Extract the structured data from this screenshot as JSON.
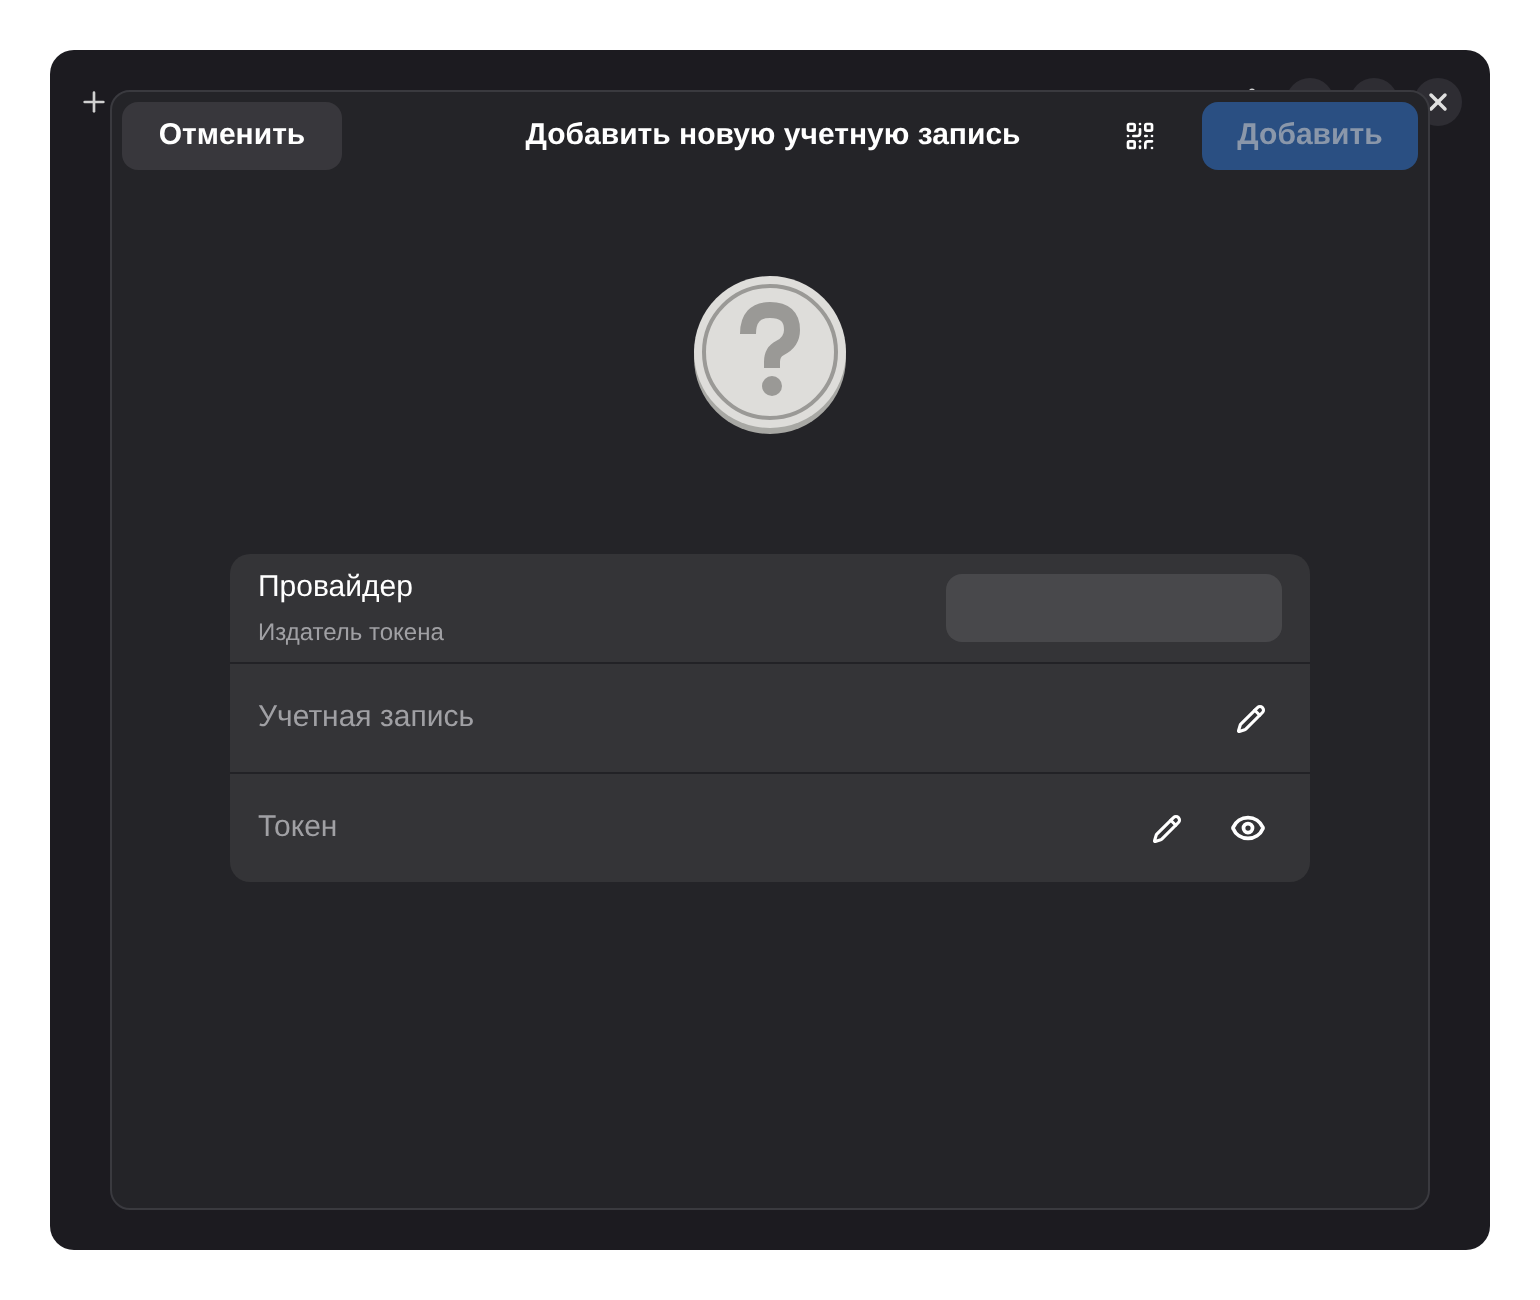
{
  "dialog": {
    "title": "Добавить новую учетную запись",
    "cancel_button": "Отменить",
    "add_button": {
      "label": "Добавить",
      "disabled": true
    }
  },
  "rows": [
    {
      "kind": "provider",
      "title": "Провайдер",
      "subtitle": "Издатель токена"
    },
    {
      "kind": "entry",
      "placeholder": "Учетная запись",
      "reveal": false
    },
    {
      "kind": "entry",
      "placeholder": "Токен",
      "reveal": true
    }
  ]
}
